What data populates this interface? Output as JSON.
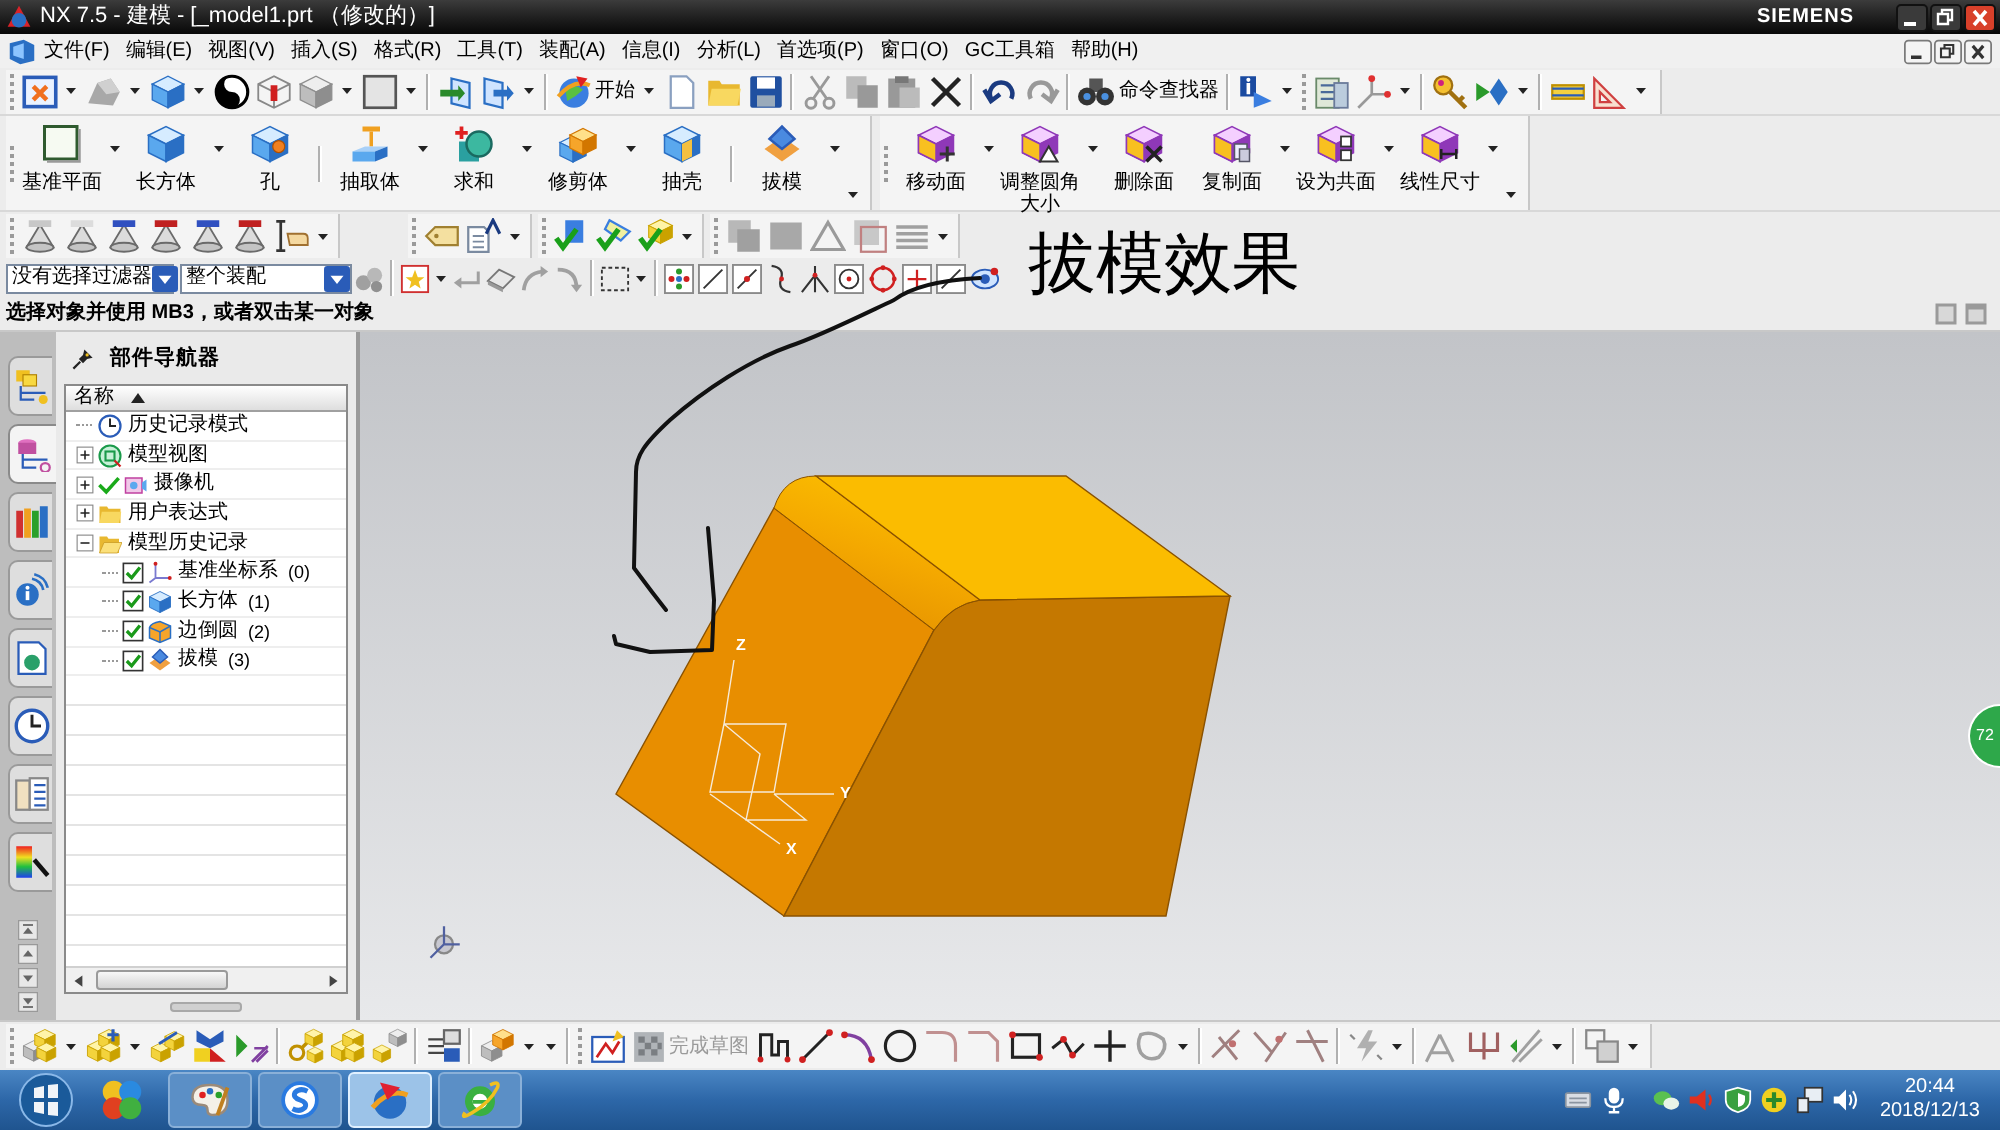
{
  "window": {
    "title": "NX 7.5 - 建模 - [_model1.prt （修改的）]",
    "brand": "SIEMENS"
  },
  "menu_bar": [
    {
      "label": "文件(F)"
    },
    {
      "label": "编辑(E)"
    },
    {
      "label": "视图(V)"
    },
    {
      "label": "插入(S)"
    },
    {
      "label": "格式(R)"
    },
    {
      "label": "工具(T)"
    },
    {
      "label": "装配(A)"
    },
    {
      "label": "信息(I)"
    },
    {
      "label": "分析(L)"
    },
    {
      "label": "首选项(P)"
    },
    {
      "label": "窗口(O)"
    },
    {
      "label": "GC工具箱"
    },
    {
      "label": "帮助(H)"
    }
  ],
  "standard_toolbar": {
    "start_button": "开始",
    "command_finder": "命令查找器"
  },
  "feature_toolbar": {
    "groups": [
      {
        "buttons": [
          {
            "label": "基准平面",
            "kind": "plane",
            "dropdown": true
          },
          {
            "label": "长方体",
            "kind": "block",
            "dropdown": true
          },
          {
            "label": "孔",
            "kind": "hole",
            "dropdown": false
          }
        ]
      },
      {
        "buttons": [
          {
            "label": "抽取体",
            "kind": "extract",
            "dropdown": true
          },
          {
            "label": "求和",
            "kind": "unite",
            "dropdown": true
          },
          {
            "label": "修剪体",
            "kind": "trim",
            "dropdown": true
          },
          {
            "label": "抽壳",
            "kind": "shell",
            "dropdown": false
          }
        ]
      },
      {
        "buttons": [
          {
            "label": "拔模",
            "kind": "draft",
            "dropdown": true
          }
        ]
      }
    ]
  },
  "synchronous_toolbar": {
    "buttons": [
      {
        "label": "移动面",
        "kind": "move_face",
        "dropdown": true
      },
      {
        "label": "调整圆角大小",
        "kind": "resize_blend",
        "dropdown": true
      },
      {
        "label": "删除面",
        "kind": "delete_face",
        "dropdown": false
      },
      {
        "label": "复制面",
        "kind": "copy_face",
        "dropdown": true
      },
      {
        "label": "设为共面",
        "kind": "coplanar",
        "dropdown": true
      },
      {
        "label": "线性尺寸",
        "kind": "linear_dim",
        "dropdown": true
      }
    ]
  },
  "selection_bar": {
    "type_filter": "没有选择过滤器",
    "scope": "整个装配"
  },
  "cue_line": "选择对象并使用 MB3，或者双击某一对象",
  "resource_bar": {
    "tabs": [
      {
        "kind": "assembly",
        "selected": false
      },
      {
        "kind": "part",
        "selected": true
      },
      {
        "kind": "library",
        "selected": false
      },
      {
        "kind": "hd3d",
        "selected": false
      },
      {
        "kind": "web",
        "selected": false
      },
      {
        "kind": "history",
        "selected": false
      },
      {
        "kind": "roles",
        "selected": false
      },
      {
        "kind": "palette",
        "selected": false
      }
    ]
  },
  "part_navigator": {
    "title": "部件导航器",
    "column": "名称",
    "nodes": [
      {
        "label": "历史记录模式",
        "kind": "clock"
      },
      {
        "label": "模型视图",
        "kind": "views",
        "expanded": false
      },
      {
        "label": "摄像机",
        "kind": "camera",
        "expanded": false,
        "checked": true
      },
      {
        "label": "用户表达式",
        "kind": "folder",
        "expanded": false
      },
      {
        "label": "模型历史记录",
        "kind": "folder_open",
        "expanded": true,
        "children": [
          {
            "label": "基准坐标系",
            "number": "(0)",
            "kind": "csys",
            "checked": true
          },
          {
            "label": "长方体",
            "number": "(1)",
            "kind": "block",
            "checked": true
          },
          {
            "label": "边倒圆",
            "number": "(2)",
            "kind": "blend",
            "checked": true
          },
          {
            "label": "拔模",
            "number": "(3)",
            "kind": "draft",
            "checked": true
          }
        ]
      }
    ]
  },
  "graphics": {
    "triad_labels": [
      "Z",
      "Y",
      "X"
    ],
    "annotation": "拔模效果",
    "badge": "72"
  },
  "sketch_toolbar": {
    "finish_sketch": {
      "label": "完成草图",
      "disabled": true
    }
  },
  "taskbar": {
    "buttons": [
      {
        "kind": "paint",
        "selected": false
      },
      {
        "kind": "sogou",
        "selected": false
      },
      {
        "kind": "nx",
        "selected": true
      },
      {
        "kind": "ie",
        "selected": false
      }
    ],
    "time": "20:44",
    "date": "2018/12/13"
  }
}
